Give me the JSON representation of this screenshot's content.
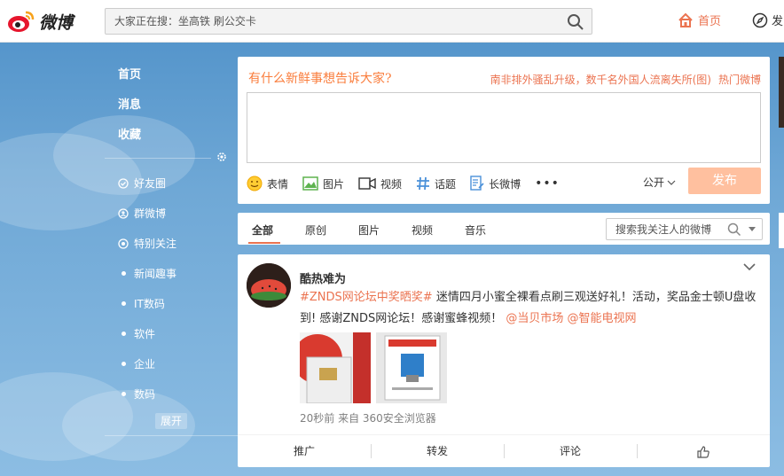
{
  "topbar": {
    "logo_text": "微博",
    "search_placeholder": "大家正在搜：坐高铁 刷公交卡",
    "home_label": "首页",
    "discover_label": "发"
  },
  "leftnav": {
    "main": [
      "首页",
      "消息",
      "收藏"
    ],
    "groups": [
      {
        "label": "好友圈",
        "icon": "circle-check-icon"
      },
      {
        "label": "群微博",
        "icon": "person-icon"
      },
      {
        "label": "特别关注",
        "icon": "target-icon"
      },
      {
        "label": "新闻趣事",
        "icon": "dot"
      },
      {
        "label": "IT数码",
        "icon": "dot"
      },
      {
        "label": "软件",
        "icon": "dot"
      },
      {
        "label": "企业",
        "icon": "dot"
      },
      {
        "label": "数码",
        "icon": "dot"
      }
    ],
    "expand_label": "展开"
  },
  "compose": {
    "prompt": "有什么新鲜事想告诉大家?",
    "hot_topic": "南非排外骚乱升级，数千名外国人流离失所(图)",
    "hot_link": "热门微博",
    "tools": [
      "表情",
      "图片",
      "视频",
      "话题",
      "长微博"
    ],
    "more": "•••",
    "visibility": "公开",
    "post_button": "发布"
  },
  "tabs": {
    "items": [
      "全部",
      "原创",
      "图片",
      "视频",
      "音乐"
    ],
    "active": "全部",
    "search_placeholder": "搜索我关注人的微博"
  },
  "feed": {
    "username": "酷热难为",
    "topic": "#ZNDS网论坛中奖晒奖#",
    "text1": " 迷情四月小蜜全裸看点刷三观送好礼！活动，奖品金士顿U盘收到! 感谢ZNDS网论坛！感谢蜜蜂视频！",
    "mention1": "@当贝市场",
    "mention2": "@智能电视网",
    "meta": "20秒前 来自 360安全浏览器",
    "actions": [
      "推广",
      "转发",
      "评论"
    ]
  },
  "colors": {
    "accent": "#eb7350",
    "background": "#6fa8d6",
    "post_button": "#ffc09f"
  }
}
